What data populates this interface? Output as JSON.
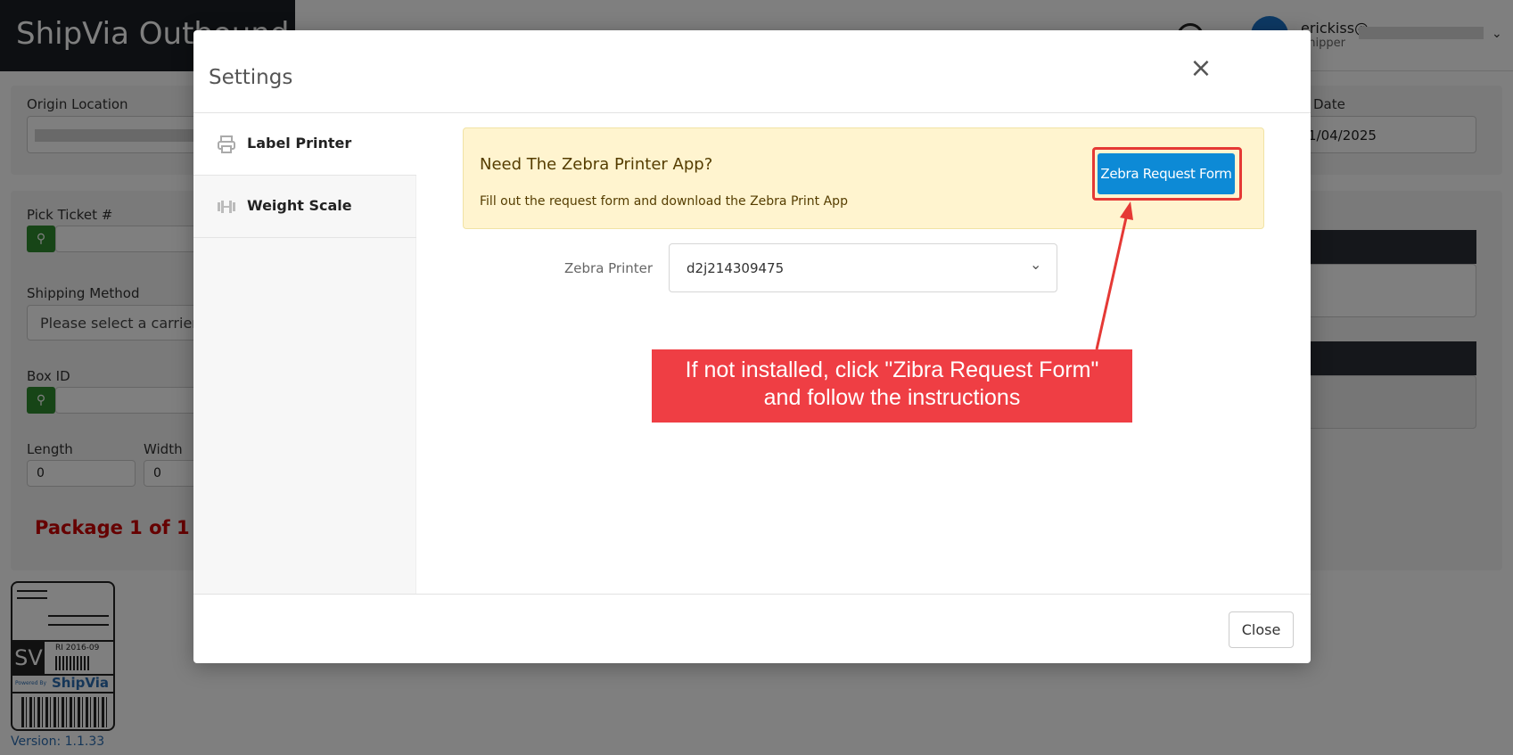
{
  "app": {
    "brand": "ShipVia Outbound",
    "user_name": "erickiss@",
    "user_role": "Shipper",
    "version": "Version: 1.1.33"
  },
  "background_form": {
    "origin_location_label": "Origin Location",
    "date_label": "Date",
    "date_value": "1/04/2025",
    "pick_ticket_label": "Pick Ticket #",
    "shipping_method_label": "Shipping Method",
    "shipping_method_placeholder": "Please select a carrier",
    "box_id_label": "Box ID",
    "length_label": "Length",
    "length_value": "0",
    "width_label": "Width",
    "width_value": "0",
    "package_text": "Package 1 of 1"
  },
  "logo": {
    "sv_text": "SV",
    "code_text": "RI 2016-09",
    "powered_by": "Powered By",
    "brand_text": "ShipVia"
  },
  "modal": {
    "title": "Settings",
    "close_label": "Close",
    "nav": [
      {
        "label": "Label Printer",
        "icon": "printer-icon"
      },
      {
        "label": "Weight Scale",
        "icon": "dumbbell-icon"
      }
    ],
    "alert": {
      "title": "Need The Zebra Printer App?",
      "text": "Fill out the request form and download the Zebra Print App",
      "button_label": "Zebra Request Form"
    },
    "printer_field_label": "Zebra Printer",
    "printer_value": "d2j214309475"
  },
  "annotation": {
    "callout_line1": "If not installed, click \"Zibra Request Form\"",
    "callout_line2": "and follow the instructions",
    "color": "#ef3e44"
  },
  "colors": {
    "primary_button": "#0d8ad6",
    "brand_bg": "#1b1f24",
    "alert_bg": "#fff4cf",
    "package_text": "#cc0000"
  }
}
